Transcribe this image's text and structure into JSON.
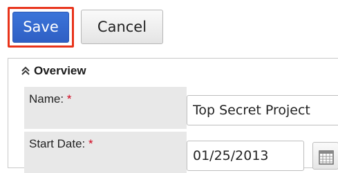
{
  "toolbar": {
    "save_label": "Save",
    "cancel_label": "Cancel",
    "highlight_color": "#e8331a",
    "save_color": "#3569d0"
  },
  "panel": {
    "title": "Overview",
    "toggle_icon": "double-chevron-up-icon",
    "fields": {
      "name": {
        "label": "Name:",
        "required_mark": "*",
        "value": "Top Secret Project"
      },
      "start_date": {
        "label": "Start Date:",
        "required_mark": "*",
        "value": "01/25/2013",
        "picker_icon": "calendar-icon"
      }
    }
  }
}
